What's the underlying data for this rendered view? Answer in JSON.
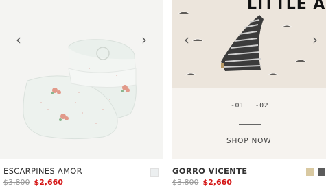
{
  "products": [
    {
      "name": "ESCARPINES AMOR",
      "old_price": "$3,800",
      "new_price": "$2,660",
      "swatch_colors": [
        "#eceff0"
      ]
    },
    {
      "name": "GORRO VICENTE",
      "old_price": "$3,800",
      "new_price": "$2,660",
      "banner_text": "LITTLE A",
      "slides": [
        "-01",
        "-02"
      ],
      "cta": "SHOP NOW",
      "swatch_colors": [
        "#d9c9a1",
        "#5b5b5b"
      ]
    }
  ],
  "icons": {
    "prev": "‹",
    "next": "›"
  }
}
